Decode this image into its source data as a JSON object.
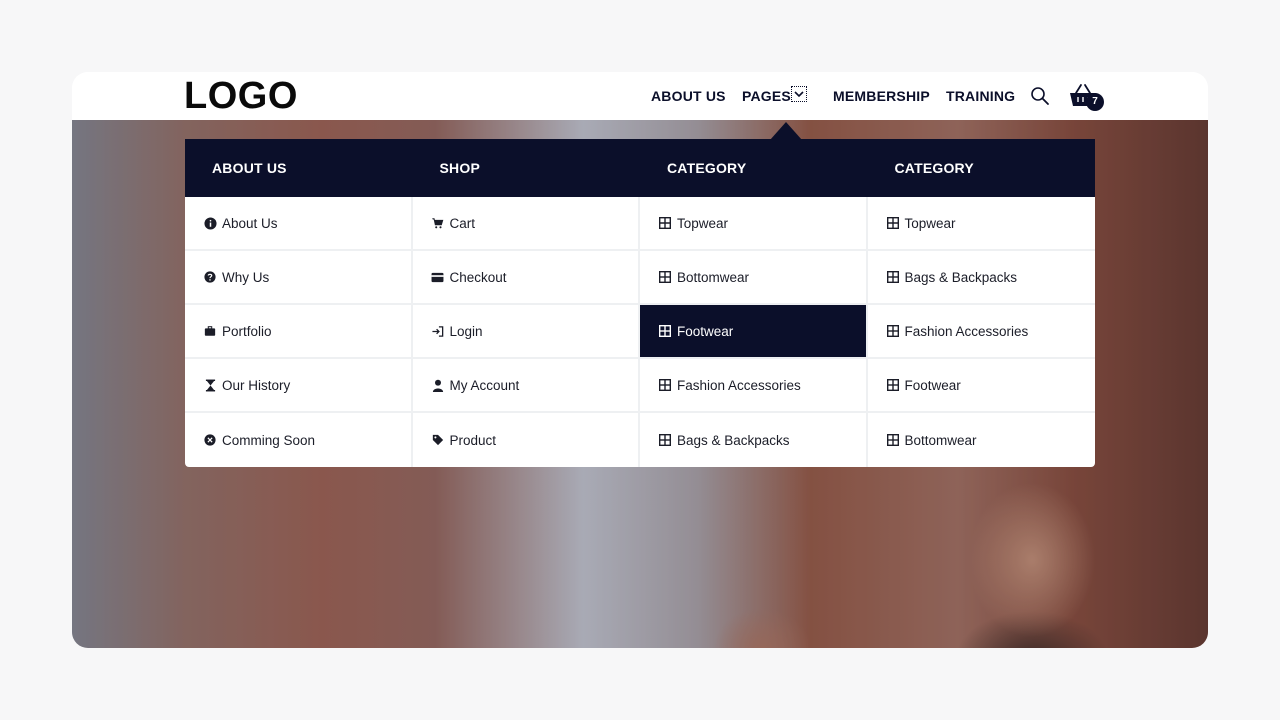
{
  "header": {
    "logo": "LOGO",
    "nav": {
      "about": "ABOUT US",
      "pages": "PAGES",
      "membership": "MEMBERSHIP",
      "training": "TRAINING"
    },
    "cart_count": "7"
  },
  "mega_menu": {
    "columns": [
      {
        "title": "ABOUT US",
        "items": [
          {
            "label": "About Us",
            "icon": "info-icon"
          },
          {
            "label": "Why Us",
            "icon": "question-icon"
          },
          {
            "label": "Portfolio",
            "icon": "briefcase-icon"
          },
          {
            "label": "Our History",
            "icon": "hourglass-icon"
          },
          {
            "label": "Comming Soon",
            "icon": "clock-icon"
          }
        ]
      },
      {
        "title": "SHOP",
        "items": [
          {
            "label": "Cart",
            "icon": "cart-icon"
          },
          {
            "label": "Checkout",
            "icon": "credit-card-icon"
          },
          {
            "label": "Login",
            "icon": "login-icon"
          },
          {
            "label": "My Account",
            "icon": "user-icon"
          },
          {
            "label": "Product",
            "icon": "tag-icon"
          }
        ]
      },
      {
        "title": "CATEGORY",
        "items": [
          {
            "label": "Topwear",
            "icon": "grid-icon"
          },
          {
            "label": "Bottomwear",
            "icon": "grid-icon"
          },
          {
            "label": "Footwear",
            "icon": "grid-icon",
            "active": true
          },
          {
            "label": "Fashion Accessories",
            "icon": "grid-icon"
          },
          {
            "label": "Bags & Backpacks",
            "icon": "grid-icon"
          }
        ]
      },
      {
        "title": "CATEGORY",
        "items": [
          {
            "label": "Topwear",
            "icon": "grid-icon"
          },
          {
            "label": "Bags & Backpacks",
            "icon": "grid-icon"
          },
          {
            "label": "Fashion Accessories",
            "icon": "grid-icon"
          },
          {
            "label": "Footwear",
            "icon": "grid-icon"
          },
          {
            "label": "Bottomwear",
            "icon": "grid-icon"
          }
        ]
      }
    ]
  },
  "colors": {
    "navy": "#0b0f2a",
    "divider": "#eef0f2",
    "text": "#1b1d28"
  }
}
